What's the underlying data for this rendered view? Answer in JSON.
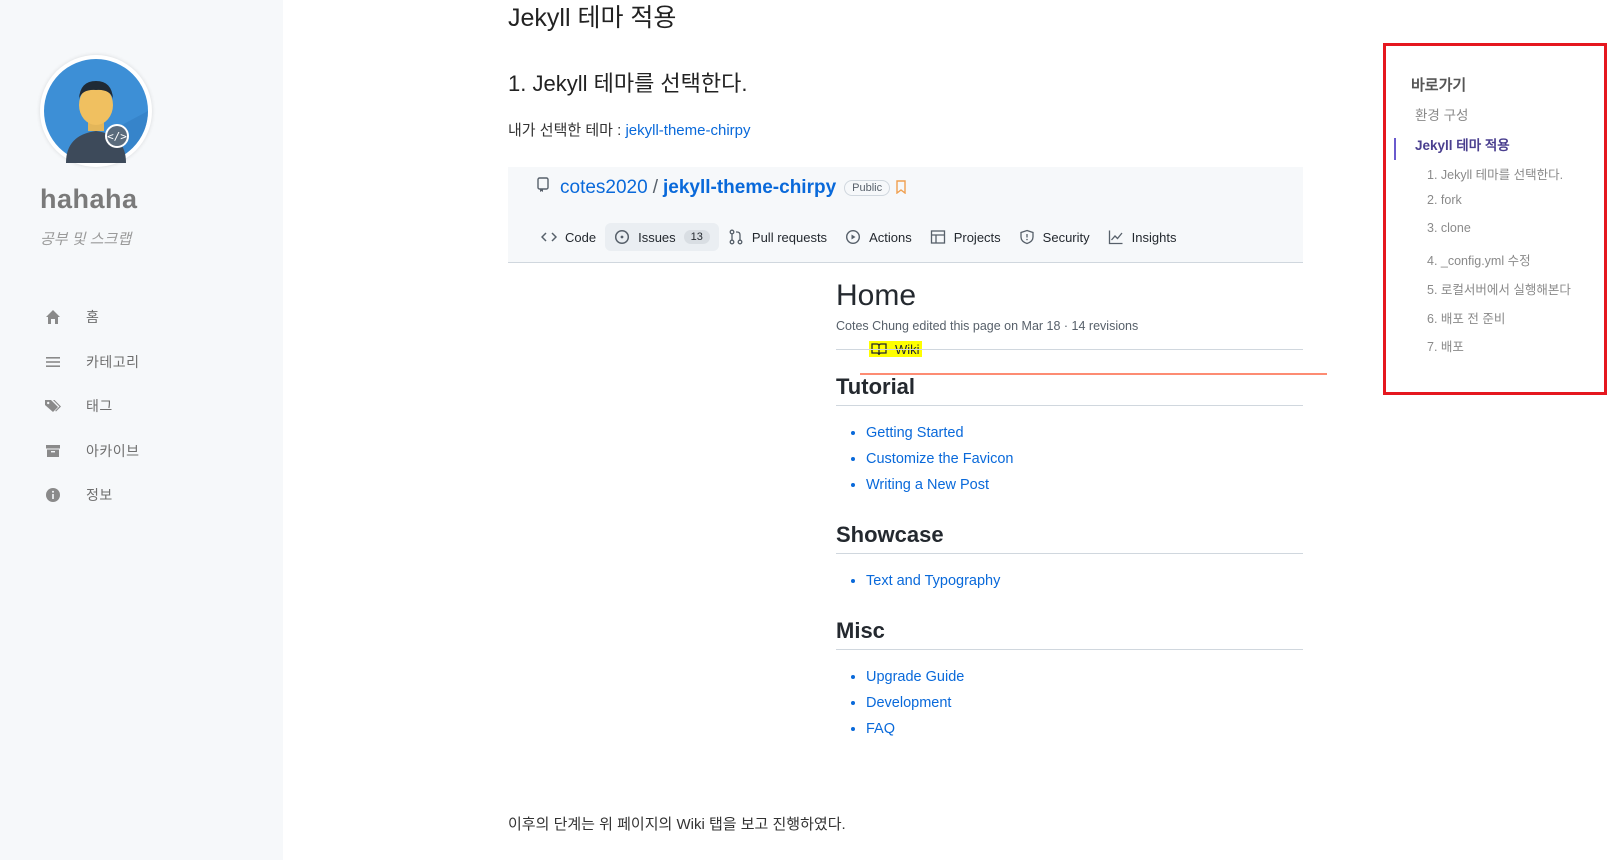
{
  "sidebar": {
    "site_title": "hahaha",
    "site_subtitle": "공부 및 스크랩",
    "nav": [
      {
        "label": "홈",
        "icon": "home-icon"
      },
      {
        "label": "카테고리",
        "icon": "stream-icon"
      },
      {
        "label": "태그",
        "icon": "tags-icon"
      },
      {
        "label": "아카이브",
        "icon": "archive-icon"
      },
      {
        "label": "정보",
        "icon": "info-icon"
      }
    ]
  },
  "post": {
    "heading": "Jekyll 테마 적용",
    "subheading": "1. Jekyll 테마를 선택한다.",
    "intro_prefix": "내가 선택한 테마 : ",
    "intro_link": "jekyll-theme-chirpy",
    "outro": "이후의 단계는 위 페이지의 Wiki 탭을 보고 진행하였다."
  },
  "github": {
    "owner": "cotes2020",
    "slash": "/",
    "repo": "jekyll-theme-chirpy",
    "visibility": "Public",
    "tabs": {
      "code": "Code",
      "issues": "Issues",
      "issues_count": "13",
      "pulls": "Pull requests",
      "actions": "Actions",
      "projects": "Projects",
      "wiki": "Wiki",
      "security": "Security",
      "insights": "Insights"
    },
    "wiki": {
      "title": "Home",
      "meta": "Cotes Chung edited this page on Mar 18 · 14 revisions",
      "sections": {
        "tutorial": {
          "heading": "Tutorial",
          "items": [
            "Getting Started",
            "Customize the Favicon",
            "Writing a New Post"
          ]
        },
        "showcase": {
          "heading": "Showcase",
          "items": [
            "Text and Typography"
          ]
        },
        "misc": {
          "heading": "Misc",
          "items": [
            "Upgrade Guide",
            "Development",
            "FAQ"
          ]
        }
      }
    }
  },
  "toc": {
    "title": "바로가기",
    "items": [
      "환경 구성",
      "Jekyll 테마 적용",
      "1. Jekyll 테마를 선택한다.",
      "2. fork",
      "3. clone",
      "4. _config.yml 수정",
      "5. 로컬서버에서 실행해본다",
      "6. 배포 전 준비",
      "7. 배포"
    ],
    "active": "Jekyll 테마 적용",
    "highlight_color": "#e5171f"
  }
}
